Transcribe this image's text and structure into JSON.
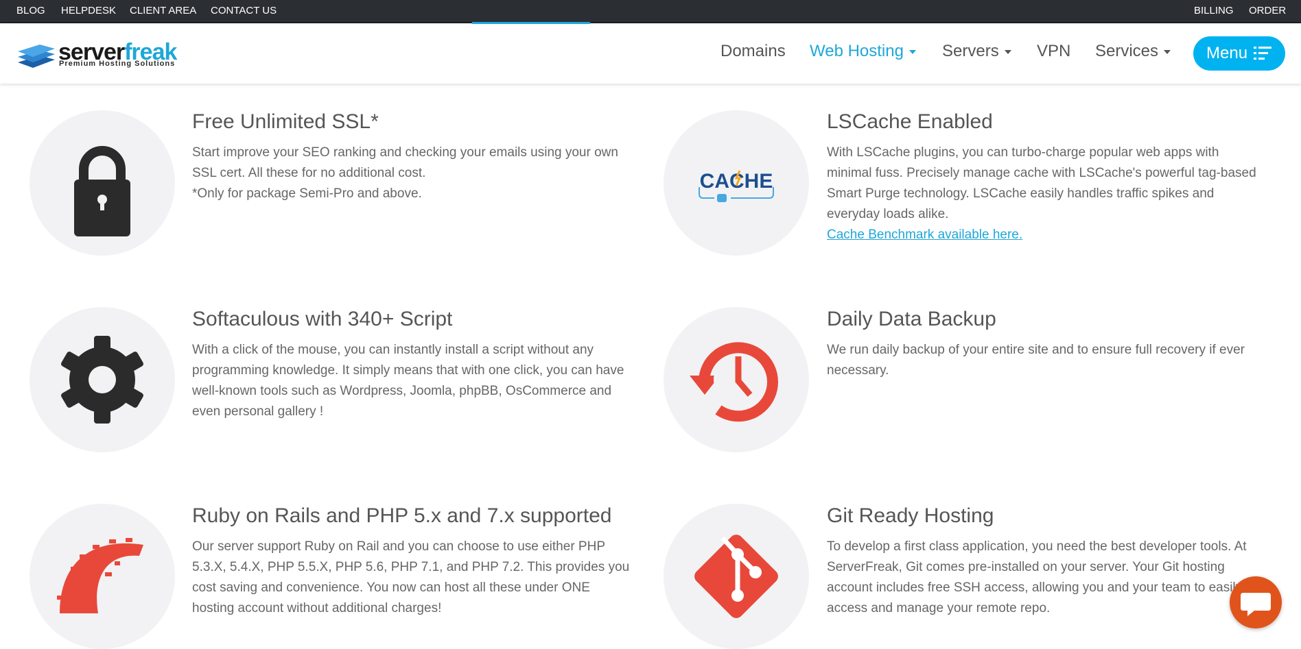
{
  "topbar": {
    "left_links": [
      "BLOG",
      "HELPDESK",
      "CLIENT AREA",
      "CONTACT US"
    ],
    "right_links": [
      "BILLING",
      "ORDER"
    ]
  },
  "logo": {
    "word_dark": "server",
    "word_accent": "freak",
    "tagline": "Premium Hosting Solutions"
  },
  "nav": {
    "items": [
      "Domains",
      "Web Hosting",
      "Servers",
      "VPN",
      "Services"
    ],
    "active": "Web Hosting",
    "menu_label": "Menu"
  },
  "features": [
    {
      "icon": "padlock-icon",
      "title": "Free Unlimited SSL*",
      "desc": [
        "Start improve your SEO ranking and checking your emails using your own",
        "SSL cert. All these for no additional cost.",
        "*Only for package Semi-Pro and above."
      ]
    },
    {
      "icon": "cache-icon",
      "icon_text": "CACHE",
      "title": "LSCache Enabled",
      "desc": [
        "With LSCache plugins, you can turbo-charge popular web apps with",
        "minimal fuss. Precisely manage cache with LSCache's powerful tag-based",
        "Smart Purge technology. LSCache easily handles traffic spikes and",
        "everyday loads alike. "
      ],
      "link": "Cache Benchmark available here."
    },
    {
      "icon": "gear-icon",
      "title": "Softaculous with 340+ Script",
      "desc": [
        "With a click of the mouse, you can instantly install a script without any",
        "programming knowledge. It simply means that with one click, you can have",
        "well-known tools such as Wordpress, Joomla, phpBB, OsCommerce and",
        "even personal gallery !"
      ]
    },
    {
      "icon": "backup-clock-icon",
      "title": "Daily Data Backup",
      "desc": [
        "We run daily backup of your entire site and to ensure full recovery if ever",
        "necessary."
      ]
    },
    {
      "icon": "rails-icon",
      "title": "Ruby on Rails and PHP 5.x and 7.x supported",
      "desc": [
        "Our server support Ruby on Rail and you can choose to use either PHP",
        "5.3.X, 5.4.X, PHP 5.5.X, PHP 5.6, PHP 7.1, and PHP 7.2. This provides you",
        "cost saving and convenience. You now can host all these under ONE",
        "hosting account without additional charges!"
      ]
    },
    {
      "icon": "git-icon",
      "title": "Git Ready Hosting",
      "desc": [
        "To develop a first class application, you need the best developer tools. At",
        "ServerFreak, Git comes pre-installed on your server. Your Git hosting",
        "account includes free SSH access, allowing you and your team to easily",
        "access and manage your remote repo."
      ]
    }
  ],
  "colors": {
    "accent": "#1ea7d8",
    "button": "#00b3f0",
    "topbar": "#2b2e33",
    "icon_red": "#e8483a",
    "chat": "#e0541c"
  }
}
